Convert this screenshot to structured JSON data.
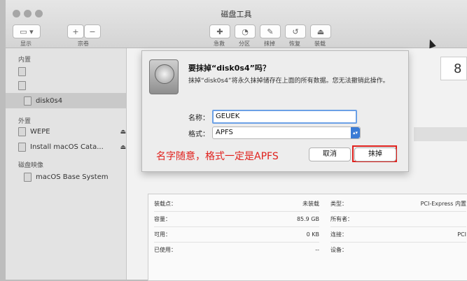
{
  "window": {
    "title": "磁盘工具"
  },
  "toolbar": {
    "view_label": "显示",
    "volume_label": "宗卷",
    "plus": "+",
    "minus": "−",
    "first_aid": "急救",
    "partition": "分区",
    "erase": "抹掉",
    "restore": "恢复",
    "mount": "装载"
  },
  "sidebar": {
    "internal_header": "内置",
    "internal_items": [
      {
        "label": ""
      },
      {
        "label": ""
      },
      {
        "label": "disk0s4"
      }
    ],
    "external_header": "外置",
    "external_items": [
      {
        "label": "WEPE"
      },
      {
        "label": "Install macOS Cata..."
      }
    ],
    "images_header": "磁盘映像",
    "image_items": [
      {
        "label": "macOS Base System"
      }
    ],
    "eject": "⏏"
  },
  "main": {
    "size_partial": "8",
    "info_left": [
      {
        "label": "装载点：",
        "value": "未装载"
      },
      {
        "label": "容量：",
        "value": "85.9 GB"
      },
      {
        "label": "可用：",
        "value": "0 KB"
      },
      {
        "label": "已使用：",
        "value": "--"
      }
    ],
    "info_right": [
      {
        "label": "类型：",
        "value": "PCI-Express 内置"
      },
      {
        "label": "所有者：",
        "value": ""
      },
      {
        "label": "连接：",
        "value": "PCI"
      },
      {
        "label": "设备：",
        "value": ""
      }
    ]
  },
  "dialog": {
    "title": "要抹掉“disk0s4”吗？",
    "message": "抹掉“disk0s4”将永久抹掉储存在上面的所有数据。您无法撤销此操作。",
    "name_label": "名称：",
    "name_value": "GEUEK",
    "format_label": "格式：",
    "format_value": "APFS",
    "cancel": "取消",
    "erase": "抹掉"
  },
  "annotation": {
    "text": "名字随意，格式一定是APFS",
    "color": "#e0211d"
  }
}
